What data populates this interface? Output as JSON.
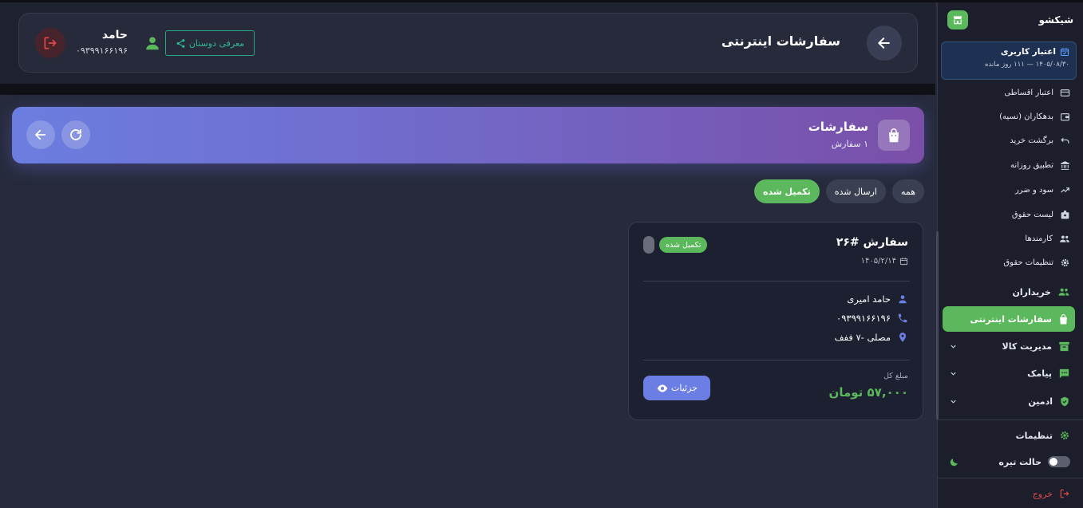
{
  "sidebar": {
    "brand": "شیکشو",
    "credit": {
      "title": "اعتبار کاربری",
      "subtitle": "۱۴۰۵/۰۸/۳۰ — ۱۱۱ روز مانده"
    },
    "sub_items": [
      {
        "label": "اعتبار اقساطی",
        "icon": "credit-card-icon"
      },
      {
        "label": "بدهکاران (نسیه)",
        "icon": "wallet-icon"
      },
      {
        "label": "برگشت خرید",
        "icon": "undo-icon"
      },
      {
        "label": "تطبیق روزانه",
        "icon": "bank-icon"
      },
      {
        "label": "سود و ضرر",
        "icon": "trending-icon"
      },
      {
        "label": "لیست حقوق",
        "icon": "badge-icon"
      },
      {
        "label": "کارمندها",
        "icon": "people-icon"
      },
      {
        "label": "تنظیمات حقوق",
        "icon": "gear-icon"
      }
    ],
    "buyers": "خریداران",
    "online_orders": "سفارشات اینترنتی",
    "product_mgmt": "مدیریت کالا",
    "sms": "پیامک",
    "admin": "ادمین",
    "settings": "تنظیمات",
    "dark_mode": "حالت تیره",
    "logout": "خروج"
  },
  "header": {
    "title": "سفارشات اینترنتی",
    "invite": "معرفی دوستان",
    "user_name": "حامد",
    "user_phone": "۰۹۳۹۹۱۶۶۱۹۶"
  },
  "banner": {
    "title": "سفارشات",
    "count": "۱ سفارش"
  },
  "filters": {
    "all": "همه",
    "sent": "ارسال شده",
    "completed": "تکمیل شده"
  },
  "order": {
    "title": "سفارش #۲۶",
    "date": "۱۴۰۵/۲/۱۴",
    "status": "تکمیل شده",
    "customer": "حامد امیری",
    "phone": "۰۹۳۹۹۱۶۶۱۹۶",
    "address": "مصلی -۷ ففف",
    "total_label": "مبلغ کل",
    "total": "۵۷,۰۰۰ تومان",
    "details": "جزئیات"
  },
  "colors": {
    "accent_green": "#5cb85c",
    "accent_blue": "#6b7ee3",
    "danger": "#e04848"
  }
}
